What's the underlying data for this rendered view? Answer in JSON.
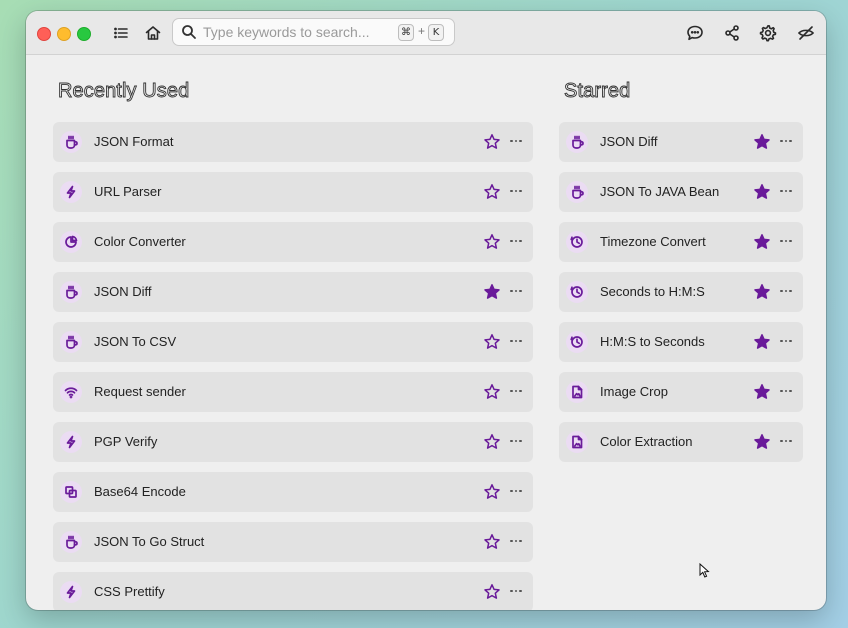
{
  "search": {
    "placeholder": "Type keywords to search...",
    "shortcut_key1": "⌘",
    "shortcut_plus": "+",
    "shortcut_key2": "K"
  },
  "toolbar": {
    "icons": [
      "menu-icon",
      "home-icon",
      "feedback-icon",
      "share-icon",
      "settings-icon",
      "no-network-icon"
    ]
  },
  "colors": {
    "accent": "#6a1b9a",
    "icon_bg": "#ebdcf3",
    "card_bg": "#e2e2e2",
    "window_bg": "#efefef"
  },
  "recent": {
    "title": "Recently Used",
    "items": [
      {
        "label": "JSON Format",
        "icon": "coffee-icon",
        "starred": false
      },
      {
        "label": "URL Parser",
        "icon": "lightning-icon",
        "starred": false
      },
      {
        "label": "Color Converter",
        "icon": "pie-chart-icon",
        "starred": false
      },
      {
        "label": "JSON Diff",
        "icon": "coffee-icon",
        "starred": true
      },
      {
        "label": "JSON To CSV",
        "icon": "coffee-icon",
        "starred": false
      },
      {
        "label": "Request sender",
        "icon": "wifi-icon",
        "starred": false
      },
      {
        "label": "PGP Verify",
        "icon": "lightning-icon",
        "starred": false
      },
      {
        "label": "Base64 Encode",
        "icon": "copy-icon",
        "starred": false
      },
      {
        "label": "JSON To Go Struct",
        "icon": "coffee-icon",
        "starred": false
      },
      {
        "label": "CSS Prettify",
        "icon": "lightning-icon",
        "starred": false
      }
    ]
  },
  "starred": {
    "title": "Starred",
    "items": [
      {
        "label": "JSON Diff",
        "icon": "coffee-icon",
        "starred": true
      },
      {
        "label": "JSON To JAVA Bean",
        "icon": "coffee-icon",
        "starred": true
      },
      {
        "label": "Timezone Convert",
        "icon": "clock-icon",
        "starred": true
      },
      {
        "label": "Seconds to H:M:S",
        "icon": "clock-icon",
        "starred": true
      },
      {
        "label": "H:M:S to Seconds",
        "icon": "clock-icon",
        "starred": true
      },
      {
        "label": "Image Crop",
        "icon": "image-file-icon",
        "starred": true
      },
      {
        "label": "Color Extraction",
        "icon": "image-file-icon",
        "starred": true
      }
    ]
  }
}
